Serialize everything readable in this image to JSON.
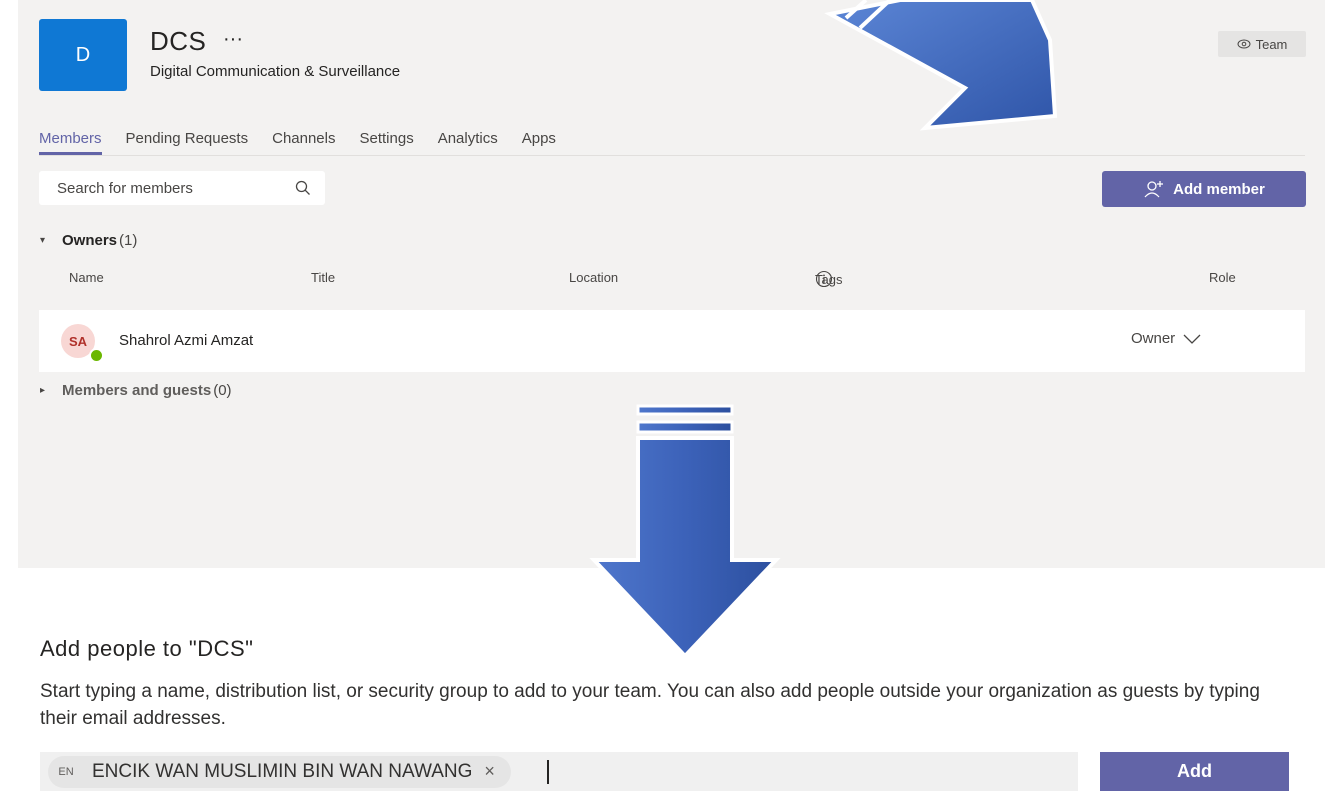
{
  "team": {
    "avatar_letter": "D",
    "name": "DCS",
    "more_icon": "···",
    "description": "Digital Communication & Surveillance",
    "badge_label": "Team"
  },
  "tabs": [
    {
      "label": "Members",
      "active": true
    },
    {
      "label": "Pending Requests",
      "active": false
    },
    {
      "label": "Channels",
      "active": false
    },
    {
      "label": "Settings",
      "active": false
    },
    {
      "label": "Analytics",
      "active": false
    },
    {
      "label": "Apps",
      "active": false
    }
  ],
  "search": {
    "placeholder": "Search for members"
  },
  "add_member_label": "Add member",
  "owners": {
    "title": "Owners",
    "count": "(1)"
  },
  "columns": {
    "name": "Name",
    "title": "Title",
    "location": "Location",
    "tags": "Tags",
    "role": "Role"
  },
  "member": {
    "initials": "SA",
    "name": "Shahrol Azmi Amzat",
    "role": "Owner"
  },
  "guests": {
    "title": "Members and guests",
    "count": "(0)"
  },
  "dialog": {
    "title": "Add people to \"DCS\"",
    "description": "Start typing a name, distribution list, or security group to add to your team. You can also add people outside your organization as guests by typing their email addresses.",
    "chip_initials": "EN",
    "chip_name": "ENCIK WAN MUSLIMIN BIN WAN NAWANG",
    "chip_remove": "×",
    "add_label": "Add"
  },
  "colors": {
    "accent": "#6264a7",
    "team_avatar": "#0f78d4",
    "arrow": "#3a62b8"
  }
}
